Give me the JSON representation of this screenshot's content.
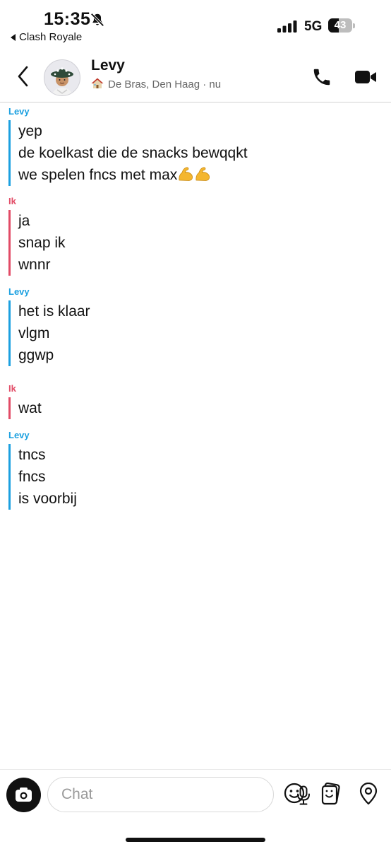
{
  "status_bar": {
    "time": "15:35",
    "back_app": "Clash Royale",
    "network": "5G",
    "battery": "43",
    "battery_level": 0.43
  },
  "header": {
    "contact_name": "Levy",
    "location": "De Bras, Den Haag · nu"
  },
  "messages": [
    {
      "sender": "Levy",
      "lines": [
        "yep",
        "de koelkast die de snacks bewqqkt",
        "we spelen fncs met max"
      ]
    },
    {
      "sender": "Ik",
      "lines": [
        "ja",
        "snap ik",
        "wnnr"
      ]
    },
    {
      "sender": "Levy",
      "lines": [
        "het is klaar",
        "vlgm",
        "ggwp"
      ]
    },
    {
      "sender": "Ik",
      "lines": [
        "wat"
      ]
    },
    {
      "sender": "Levy",
      "lines": [
        "tncs",
        "fncs",
        "is voorbij"
      ]
    }
  ],
  "composer": {
    "placeholder": "Chat"
  },
  "icons": {
    "status": [
      "bell-off-icon",
      "signal-icon",
      "battery-icon"
    ],
    "header": [
      "back-arrow-icon",
      "phone-icon",
      "video-camera-icon",
      "house-emoji-icon"
    ],
    "composer": [
      "camera-icon",
      "microphone-icon",
      "smiley-icon",
      "sticker-icon",
      "location-pin-icon"
    ],
    "inline": [
      "flexed-biceps-emoji"
    ]
  },
  "colors": {
    "friend_accent": "#1ba0e0",
    "me_accent": "#e24b66",
    "muscle_emoji": "#f4b62f"
  }
}
